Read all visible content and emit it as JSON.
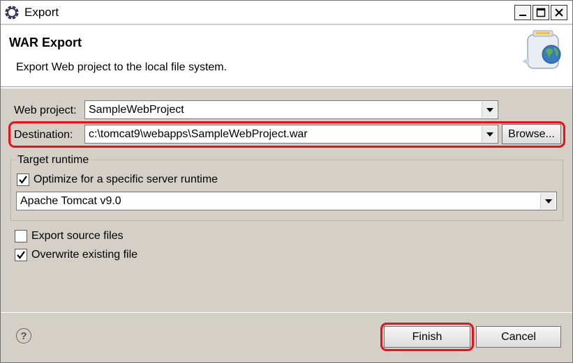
{
  "window": {
    "title": "Export",
    "icon": "eclipse-gear-icon"
  },
  "banner": {
    "title": "WAR Export",
    "description": "Export Web project to the local file system.",
    "icon": "jar-globe-icon"
  },
  "form": {
    "web_project_label": "Web project:",
    "web_project_value": "SampleWebProject",
    "destination_label": "Destination:",
    "destination_value": "c:\\tomcat9\\webapps\\SampleWebProject.war",
    "browse_label": "Browse...",
    "target_runtime_title": "Target runtime",
    "optimize_label": "Optimize for a specific server runtime",
    "optimize_checked": true,
    "runtime_value": "Apache Tomcat v9.0",
    "export_source_label": "Export source files",
    "export_source_checked": false,
    "overwrite_label": "Overwrite existing file",
    "overwrite_checked": true
  },
  "footer": {
    "help_symbol": "?",
    "finish_label": "Finish",
    "cancel_label": "Cancel"
  },
  "colors": {
    "highlight": "#e8111a",
    "dialog_bg": "#d4d0c8"
  }
}
